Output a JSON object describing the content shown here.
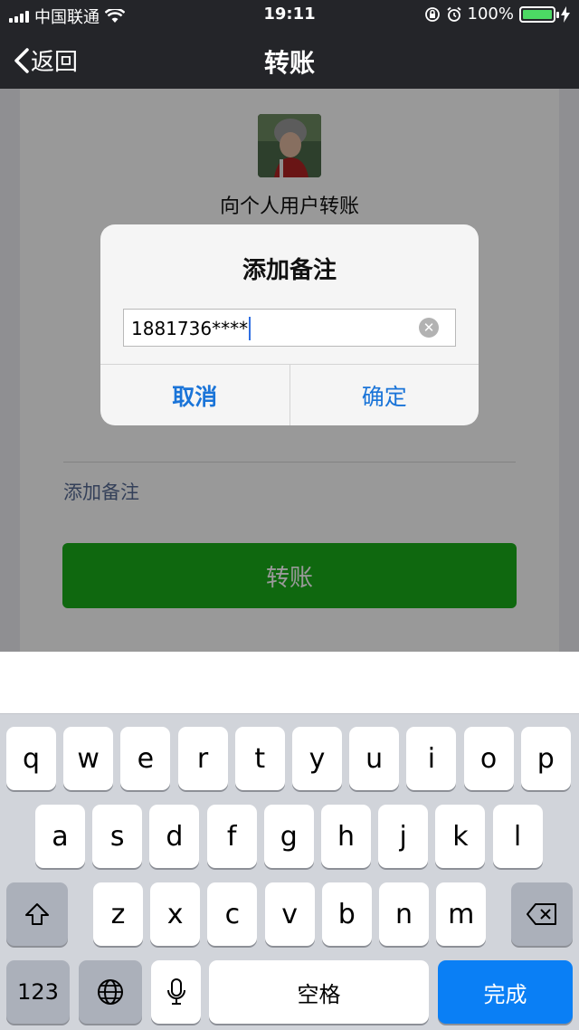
{
  "status_bar": {
    "carrier": "中国联通",
    "time": "19:11",
    "battery": "100%",
    "battery_level": 1.0
  },
  "nav": {
    "back_label": "返回",
    "title": "转账"
  },
  "page": {
    "recipient_label": "向个人用户转账",
    "add_remark_link": "添加备注",
    "transfer_button": "转账"
  },
  "dialog": {
    "title": "添加备注",
    "input_value": "1881736****",
    "cancel_label": "取消",
    "confirm_label": "确定"
  },
  "keyboard": {
    "row1": [
      "q",
      "w",
      "e",
      "r",
      "t",
      "y",
      "u",
      "i",
      "o",
      "p"
    ],
    "row2": [
      "a",
      "s",
      "d",
      "f",
      "g",
      "h",
      "j",
      "k",
      "l"
    ],
    "row3": [
      "z",
      "x",
      "c",
      "v",
      "b",
      "n",
      "m"
    ],
    "numbers_key": "123",
    "space_key": "空格",
    "done_key": "完成"
  },
  "colors": {
    "nav_bg": "#242529",
    "transfer_green": "#1aad19",
    "dialog_blue": "#1a74d8",
    "done_blue": "#0a7ff5"
  }
}
